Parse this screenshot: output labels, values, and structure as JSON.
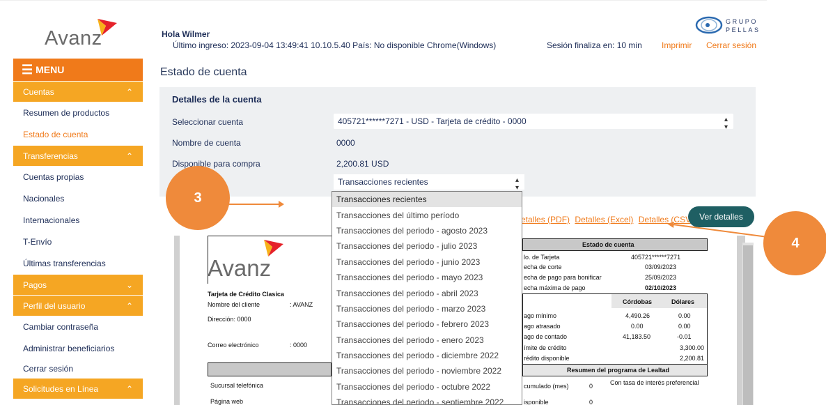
{
  "header": {
    "logo_text": "Avanz",
    "greeting": "Hola Wilmer",
    "last_login": "Último ingreso: 2023-09-04 13:49:41 10.10.5.40 País: No disponible Chrome(Windows)",
    "session": "Sesión finaliza en: 10 min",
    "print_label": "Imprimir",
    "logout_label": "Cerrar sesión",
    "partner_line1": "GRUPO",
    "partner_line2": "PELLAS"
  },
  "sidebar": {
    "menu_label": "MENU",
    "sections": [
      {
        "label": "Cuentas",
        "items": [
          "Resumen de productos",
          "Estado de cuenta"
        ]
      },
      {
        "label": "Transferencias",
        "items": [
          "Cuentas propias",
          "Nacionales",
          "Internacionales",
          "T-Envío",
          "Últimas transferencias"
        ]
      },
      {
        "label": "Pagos",
        "items": []
      },
      {
        "label": "Perfil del usuario",
        "items": [
          "Cambiar contraseña",
          "Administrar beneficiarios",
          "Cerrar sesión"
        ]
      },
      {
        "label": "Solicitudes en Línea",
        "items": []
      }
    ],
    "active_item": "Estado de cuenta"
  },
  "main": {
    "page_title": "Estado de cuenta",
    "panel_title": "Detalles de la cuenta",
    "fields": [
      {
        "label": "Seleccionar cuenta",
        "value": "405721******7271 - USD - Tarjeta de crédito - 0000"
      },
      {
        "label": "Nombre de cuenta",
        "value": "0000"
      },
      {
        "label": "Disponible para compra",
        "value": "2,200.81 USD"
      }
    ],
    "tx_select_value": "Transacciones recientes",
    "dropdown_options": [
      "Transacciones recientes",
      "Transacciones del último período",
      "Transacciones del periodo - agosto 2023",
      "Transacciones del periodo - julio 2023",
      "Transacciones del periodo - junio 2023",
      "Transacciones del periodo - mayo 2023",
      "Transacciones del periodo - abril 2023",
      "Transacciones del periodo - marzo 2023",
      "Transacciones del periodo - febrero 2023",
      "Transacciones del periodo - enero 2023",
      "Transacciones del periodo - diciembre 2022",
      "Transacciones del periodo - noviembre 2022",
      "Transacciones del periodo - octubre 2022",
      "Transacciones del periodo - septiembre 2022"
    ],
    "download_links": [
      "etalles (PDF)",
      "Detalles (Excel)",
      "Detalles (CSV)"
    ],
    "view_button": "Ver detalles"
  },
  "statement": {
    "logo_text": "Avanz",
    "card_type": "Tarjeta de Crédito Clasica",
    "client_label": "Nombre del cliente",
    "client_value": ": AVANZ",
    "address": "Dirección: 0000",
    "email_label": "Correo electrónico",
    "email_value": ": 0000",
    "contact_rows": [
      "Sucursal telefónica",
      "Página web"
    ],
    "box_title": "Estado de cuenta",
    "card_no_label": "lo. de Tarjeta",
    "card_no": "405721******7271",
    "cut_label": "echa de corte",
    "cut_date": "03/09/2023",
    "bonus_label": "echa de pago para bonificar",
    "bonus_date": "25/09/2023",
    "max_label": "echa máxima de pago",
    "max_date": "02/10/2023",
    "col_cordobas": "Córdobas",
    "col_dolares": "Dólares",
    "rows": [
      {
        "label": "ago mínimo",
        "c": "4,490.26",
        "d": "0.00"
      },
      {
        "label": "ago atrasado",
        "c": "0.00",
        "d": "0.00"
      },
      {
        "label": "ago de contado",
        "c": "41,183.50",
        "d": "-0.01"
      }
    ],
    "limit_label": "ímite de crédito",
    "limit_value": "3,300.00",
    "avail_label": "rédito disponible",
    "avail_value": "2,200.81",
    "loyalty_title": "Resumen del programa de Lealtad",
    "acc_label": "cumulado (mes)",
    "acc_value": "0",
    "disp_label": "isponible",
    "disp_value": "0",
    "rate_note": "Con tasa de interés preferencial"
  },
  "callouts": [
    "3",
    "4"
  ]
}
